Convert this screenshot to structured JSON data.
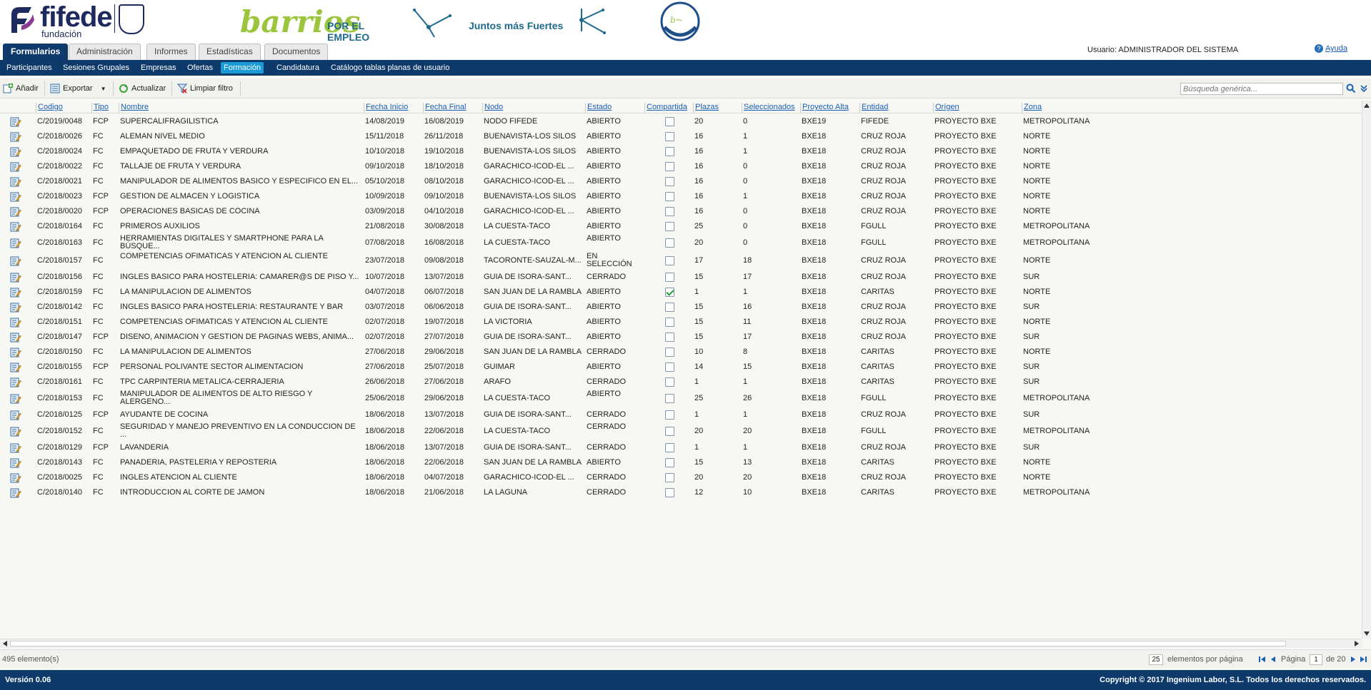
{
  "branding": {
    "fifede_word": "fifede",
    "fifede_sub": "fundación",
    "barrios_script": "barrios",
    "barrios_slogan": "POR EL EMPLEO",
    "juntos_text": "Juntos más Fuertes",
    "colors": {
      "navy": "#0d3a6b",
      "accent": "#1a9ad6",
      "green": "#9bc53d",
      "link": "#1a5fb4"
    }
  },
  "main_tabs": [
    "Formularios",
    "Administración",
    "Informes",
    "Estadísticas",
    "Documentos"
  ],
  "user_info": "Usuario: ADMINISTRADOR DEL SISTEMA",
  "help_label": "Ayuda",
  "sub_nav": [
    "Participantes",
    "Sesiones Grupales",
    "Empresas",
    "Ofertas",
    "Formación",
    "Candidatura",
    "Catálogo tablas planas de usuario"
  ],
  "active_sub_nav": "Formación",
  "toolbar": {
    "add": "Añadir",
    "export": "Exportar",
    "refresh": "Actualizar",
    "clear_filter": "Limpiar filtro",
    "search_placeholder": "Búsqueda genérica..."
  },
  "columns": [
    "Codigo",
    "Tipo",
    "Nombre",
    "Fecha Inicio",
    "Fecha Final",
    "Nodo",
    "Estado",
    "Compartida",
    "Plazas",
    "Seleccionados",
    "Proyecto Alta",
    "Entidad",
    "Orígen",
    "Zona"
  ],
  "rows": [
    {
      "codigo": "C/2019/0048",
      "tipo": "FCP",
      "nombre": "SUPERCALIFRAGILISTICA",
      "inicio": "14/08/2019",
      "final": "16/08/2019",
      "nodo": "NODO FIFEDE",
      "estado": "ABIERTO",
      "compartida": false,
      "plazas": "20",
      "seleccionados": "0",
      "proyecto": "BXE19",
      "entidad": "FIFEDE",
      "origen": "PROYECTO BXE",
      "zona": "METROPOLITANA"
    },
    {
      "codigo": "C/2018/0026",
      "tipo": "FC",
      "nombre": "ALEMAN NIVEL MEDIO",
      "inicio": "15/11/2018",
      "final": "26/11/2018",
      "nodo": "BUENAVISTA-LOS SILOS",
      "estado": "ABIERTO",
      "compartida": false,
      "plazas": "16",
      "seleccionados": "1",
      "proyecto": "BXE18",
      "entidad": "CRUZ ROJA",
      "origen": "PROYECTO BXE",
      "zona": "NORTE"
    },
    {
      "codigo": "C/2018/0024",
      "tipo": "FC",
      "nombre": "EMPAQUETADO DE FRUTA Y VERDURA",
      "inicio": "10/10/2018",
      "final": "19/10/2018",
      "nodo": "BUENAVISTA-LOS SILOS",
      "estado": "ABIERTO",
      "compartida": false,
      "plazas": "16",
      "seleccionados": "1",
      "proyecto": "BXE18",
      "entidad": "CRUZ ROJA",
      "origen": "PROYECTO BXE",
      "zona": "NORTE"
    },
    {
      "codigo": "C/2018/0022",
      "tipo": "FC",
      "nombre": "TALLAJE DE FRUTA Y VERDURA",
      "inicio": "09/10/2018",
      "final": "18/10/2018",
      "nodo": "GARACHICO-ICOD-EL ...",
      "estado": "ABIERTO",
      "compartida": false,
      "plazas": "16",
      "seleccionados": "0",
      "proyecto": "BXE18",
      "entidad": "CRUZ ROJA",
      "origen": "PROYECTO BXE",
      "zona": "NORTE"
    },
    {
      "codigo": "C/2018/0021",
      "tipo": "FC",
      "nombre": "MANIPULADOR DE ALIMENTOS BASICO Y ESPECIFICO EN EL...",
      "inicio": "05/10/2018",
      "final": "08/10/2018",
      "nodo": "GARACHICO-ICOD-EL ...",
      "estado": "ABIERTO",
      "compartida": false,
      "plazas": "16",
      "seleccionados": "0",
      "proyecto": "BXE18",
      "entidad": "CRUZ ROJA",
      "origen": "PROYECTO BXE",
      "zona": "NORTE"
    },
    {
      "codigo": "C/2018/0023",
      "tipo": "FCP",
      "nombre": "GESTION DE ALMACEN Y LOGISTICA",
      "inicio": "10/09/2018",
      "final": "09/10/2018",
      "nodo": "BUENAVISTA-LOS SILOS",
      "estado": "ABIERTO",
      "compartida": false,
      "plazas": "16",
      "seleccionados": "1",
      "proyecto": "BXE18",
      "entidad": "CRUZ ROJA",
      "origen": "PROYECTO BXE",
      "zona": "NORTE"
    },
    {
      "codigo": "C/2018/0020",
      "tipo": "FCP",
      "nombre": "OPERACIONES BASICAS DE COCINA",
      "inicio": "03/09/2018",
      "final": "04/10/2018",
      "nodo": "GARACHICO-ICOD-EL ...",
      "estado": "ABIERTO",
      "compartida": false,
      "plazas": "16",
      "seleccionados": "0",
      "proyecto": "BXE18",
      "entidad": "CRUZ ROJA",
      "origen": "PROYECTO BXE",
      "zona": "NORTE"
    },
    {
      "codigo": "C/2018/0164",
      "tipo": "FC",
      "nombre": "PRIMEROS AUXILIOS",
      "inicio": "21/08/2018",
      "final": "30/08/2018",
      "nodo": "LA CUESTA-TACO",
      "estado": "ABIERTO",
      "compartida": false,
      "plazas": "25",
      "seleccionados": "0",
      "proyecto": "BXE18",
      "entidad": "FGULL",
      "origen": "PROYECTO BXE",
      "zona": "METROPOLITANA"
    },
    {
      "codigo": "C/2018/0163",
      "tipo": "FC",
      "nombre": "HERRAMIENTAS DIGITALES Y SMARTPHONE PARA LA BÚSQUE...",
      "inicio": "07/08/2018",
      "final": "16/08/2018",
      "nodo": "LA CUESTA-TACO",
      "estado": "ABIERTO",
      "compartida": false,
      "plazas": "20",
      "seleccionados": "0",
      "proyecto": "BXE18",
      "entidad": "FGULL",
      "origen": "PROYECTO BXE",
      "zona": "METROPOLITANA",
      "tall": true
    },
    {
      "codigo": "C/2018/0157",
      "tipo": "FC",
      "nombre": "COMPETENCIAS OFIMATICAS Y ATENCION AL CLIENTE",
      "inicio": "23/07/2018",
      "final": "09/08/2018",
      "nodo": "TACORONTE-SAUZAL-M...",
      "estado": "EN SELECCIÓN",
      "compartida": false,
      "plazas": "17",
      "seleccionados": "18",
      "proyecto": "BXE18",
      "entidad": "CRUZ ROJA",
      "origen": "PROYECTO BXE",
      "zona": "NORTE",
      "tall": true
    },
    {
      "codigo": "C/2018/0156",
      "tipo": "FC",
      "nombre": "INGLES BASICO PARA HOSTELERIA: CAMARER@S DE PISO Y...",
      "inicio": "10/07/2018",
      "final": "13/07/2018",
      "nodo": "GUÍA DE ISORA-SANT...",
      "estado": "CERRADO",
      "compartida": false,
      "plazas": "15",
      "seleccionados": "17",
      "proyecto": "BXE18",
      "entidad": "CRUZ ROJA",
      "origen": "PROYECTO BXE",
      "zona": "SUR"
    },
    {
      "codigo": "C/2018/0159",
      "tipo": "FC",
      "nombre": "LA MANIPULACIÓN DE ALIMENTOS",
      "inicio": "04/07/2018",
      "final": "06/07/2018",
      "nodo": "SAN JUAN DE LA RAMBLA",
      "estado": "ABIERTO",
      "compartida": true,
      "plazas": "1",
      "seleccionados": "1",
      "proyecto": "BXE18",
      "entidad": "CARITAS",
      "origen": "PROYECTO BXE",
      "zona": "NORTE"
    },
    {
      "codigo": "C/2018/0142",
      "tipo": "FC",
      "nombre": "INGLÉS BÁSICO PARA HOSTELERÍA: RESTAURANTE Y BAR",
      "inicio": "03/07/2018",
      "final": "06/06/2018",
      "nodo": "GUÍA DE ISORA-SANT...",
      "estado": "ABIERTO",
      "compartida": false,
      "plazas": "15",
      "seleccionados": "16",
      "proyecto": "BXE18",
      "entidad": "CRUZ ROJA",
      "origen": "PROYECTO BXE",
      "zona": "SUR"
    },
    {
      "codigo": "C/2018/0151",
      "tipo": "FC",
      "nombre": "COMPETENCIAS OFIMATICAS Y ATENCION AL CLIENTE",
      "inicio": "02/07/2018",
      "final": "19/07/2018",
      "nodo": "LA VICTORIA",
      "estado": "ABIERTO",
      "compartida": false,
      "plazas": "15",
      "seleccionados": "11",
      "proyecto": "BXE18",
      "entidad": "CRUZ ROJA",
      "origen": "PROYECTO BXE",
      "zona": "NORTE"
    },
    {
      "codigo": "C/2018/0147",
      "tipo": "FCP",
      "nombre": "DISEÑO, ANIMACION Y GESTIÓN DE PAGINAS WEBS, ANIMA...",
      "inicio": "02/07/2018",
      "final": "27/07/2018",
      "nodo": "GUÍA DE ISORA-SANT...",
      "estado": "ABIERTO",
      "compartida": false,
      "plazas": "15",
      "seleccionados": "17",
      "proyecto": "BXE18",
      "entidad": "CRUZ ROJA",
      "origen": "PROYECTO BXE",
      "zona": "SUR"
    },
    {
      "codigo": "C/2018/0150",
      "tipo": "FC",
      "nombre": "LA MANIPULACIÓN DE ALIMENTOS",
      "inicio": "27/06/2018",
      "final": "29/06/2018",
      "nodo": "SAN JUAN DE LA RAMBLA",
      "estado": "CERRADO",
      "compartida": false,
      "plazas": "10",
      "seleccionados": "8",
      "proyecto": "BXE18",
      "entidad": "CARITAS",
      "origen": "PROYECTO BXE",
      "zona": "NORTE"
    },
    {
      "codigo": "C/2018/0155",
      "tipo": "FCP",
      "nombre": "PERSONAL POLIVANTE SECTOR ALIMENTACIÓN",
      "inicio": "27/06/2018",
      "final": "25/07/2018",
      "nodo": "GÜIMAR",
      "estado": "ABIERTO",
      "compartida": false,
      "plazas": "14",
      "seleccionados": "15",
      "proyecto": "BXE18",
      "entidad": "CARITAS",
      "origen": "PROYECTO BXE",
      "zona": "SUR"
    },
    {
      "codigo": "C/2018/0161",
      "tipo": "FC",
      "nombre": "TPC CARPINTERIA METÁLICA-CERRAJERIA",
      "inicio": "26/06/2018",
      "final": "27/06/2018",
      "nodo": "ARAFO",
      "estado": "CERRADO",
      "compartida": false,
      "plazas": "1",
      "seleccionados": "1",
      "proyecto": "BXE18",
      "entidad": "CARITAS",
      "origen": "PROYECTO BXE",
      "zona": "SUR"
    },
    {
      "codigo": "C/2018/0153",
      "tipo": "FC",
      "nombre": "MANIPULADOR DE ALIMENTOS DE ALTO RIESGO Y ALERGENO...",
      "inicio": "25/06/2018",
      "final": "29/06/2018",
      "nodo": "LA CUESTA-TACO",
      "estado": "ABIERTO",
      "compartida": false,
      "plazas": "25",
      "seleccionados": "26",
      "proyecto": "BXE18",
      "entidad": "FGULL",
      "origen": "PROYECTO BXE",
      "zona": "METROPOLITANA",
      "tall": true
    },
    {
      "codigo": "C/2018/0125",
      "tipo": "FCP",
      "nombre": "AYUDANTE DE COCINA",
      "inicio": "18/06/2018",
      "final": "13/07/2018",
      "nodo": "GUÍA DE ISORA-SANT...",
      "estado": "CERRADO",
      "compartida": false,
      "plazas": "1",
      "seleccionados": "1",
      "proyecto": "BXE18",
      "entidad": "CRUZ ROJA",
      "origen": "PROYECTO BXE",
      "zona": "SUR"
    },
    {
      "codigo": "C/2018/0152",
      "tipo": "FC",
      "nombre": "SEGURIDAD Y MANEJO PREVENTIVO EN LA CONDUCCIÓN DE ...",
      "inicio": "18/06/2018",
      "final": "22/06/2018",
      "nodo": "LA CUESTA-TACO",
      "estado": "CERRADO",
      "compartida": false,
      "plazas": "20",
      "seleccionados": "20",
      "proyecto": "BXE18",
      "entidad": "FGULL",
      "origen": "PROYECTO BXE",
      "zona": "METROPOLITANA",
      "tall": true
    },
    {
      "codigo": "C/2018/0129",
      "tipo": "FCP",
      "nombre": "LAVANDERIA",
      "inicio": "18/06/2018",
      "final": "13/07/2018",
      "nodo": "GUÍA DE ISORA-SANT...",
      "estado": "CERRADO",
      "compartida": false,
      "plazas": "1",
      "seleccionados": "1",
      "proyecto": "BXE18",
      "entidad": "CRUZ ROJA",
      "origen": "PROYECTO BXE",
      "zona": "SUR"
    },
    {
      "codigo": "C/2018/0143",
      "tipo": "FC",
      "nombre": "PANADERÍA, PASTELERÍA Y REPOSTERÍA",
      "inicio": "18/06/2018",
      "final": "22/06/2018",
      "nodo": "SAN JUAN DE LA RAMBLA",
      "estado": "ABIERTO",
      "compartida": false,
      "plazas": "15",
      "seleccionados": "13",
      "proyecto": "BXE18",
      "entidad": "CARITAS",
      "origen": "PROYECTO BXE",
      "zona": "NORTE"
    },
    {
      "codigo": "C/2018/0025",
      "tipo": "FC",
      "nombre": "INGLES ATENCION AL CLIENTE",
      "inicio": "18/06/2018",
      "final": "04/07/2018",
      "nodo": "GARACHICO-ICOD-EL ...",
      "estado": "CERRADO",
      "compartida": false,
      "plazas": "20",
      "seleccionados": "20",
      "proyecto": "BXE18",
      "entidad": "CRUZ ROJA",
      "origen": "PROYECTO BXE",
      "zona": "NORTE"
    },
    {
      "codigo": "C/2018/0140",
      "tipo": "FC",
      "nombre": "INTRODUCCIÓN AL CORTE DE JAMÓN",
      "inicio": "18/06/2018",
      "final": "21/06/2018",
      "nodo": "LA LAGUNA",
      "estado": "CERRADO",
      "compartida": false,
      "plazas": "12",
      "seleccionados": "10",
      "proyecto": "BXE18",
      "entidad": "CARITAS",
      "origen": "PROYECTO BXE",
      "zona": "METROPOLITANA"
    }
  ],
  "pager": {
    "count": "495 elemento(s)",
    "page_size": "25",
    "page_size_label": "elementos por página",
    "page_label": "Página",
    "page": "1",
    "page_of": "de 20"
  },
  "footer": {
    "version": "Versión 0.06",
    "copyright": "Copyright © 2017 Ingenium Labor, S.L. Todos los derechos reservados."
  }
}
